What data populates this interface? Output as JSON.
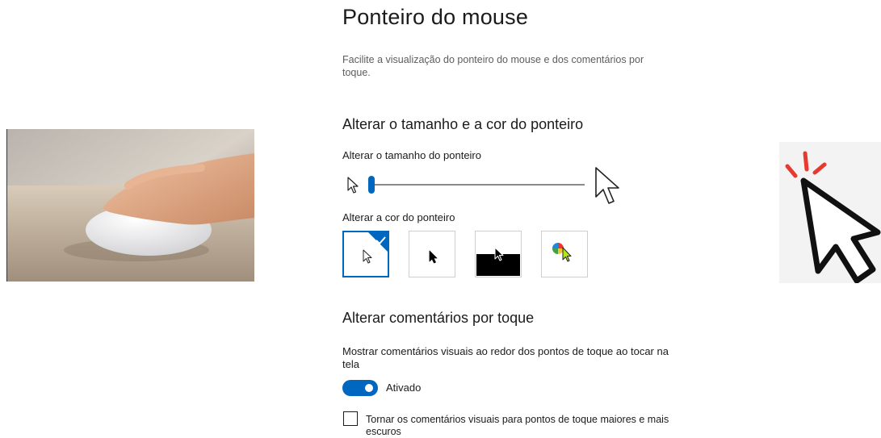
{
  "header": {
    "title": "Ponteiro do mouse",
    "description": "Facilite a visualização do ponteiro do mouse e dos comentários por toque."
  },
  "pointer_section": {
    "heading": "Alterar o tamanho e a cor do ponteiro",
    "size_label": "Alterar o tamanho do ponteiro",
    "size_value": 0.0,
    "color_label": "Alterar a cor do ponteiro",
    "color_options": [
      {
        "name": "white",
        "selected": true
      },
      {
        "name": "black",
        "selected": false
      },
      {
        "name": "inverted",
        "selected": false
      },
      {
        "name": "custom",
        "selected": false
      }
    ]
  },
  "touch_section": {
    "heading": "Alterar comentários por toque",
    "feedback_label": "Mostrar comentários visuais ao redor dos pontos de toque ao tocar na tela",
    "toggle_state": "Ativado",
    "toggle_on": true,
    "checkbox_label": "Tornar os comentários visuais para pontos de toque maiores e mais escuros",
    "checkbox_checked": false
  },
  "colors": {
    "accent": "#0067c0",
    "custom_pointer": "#b5e61d"
  }
}
